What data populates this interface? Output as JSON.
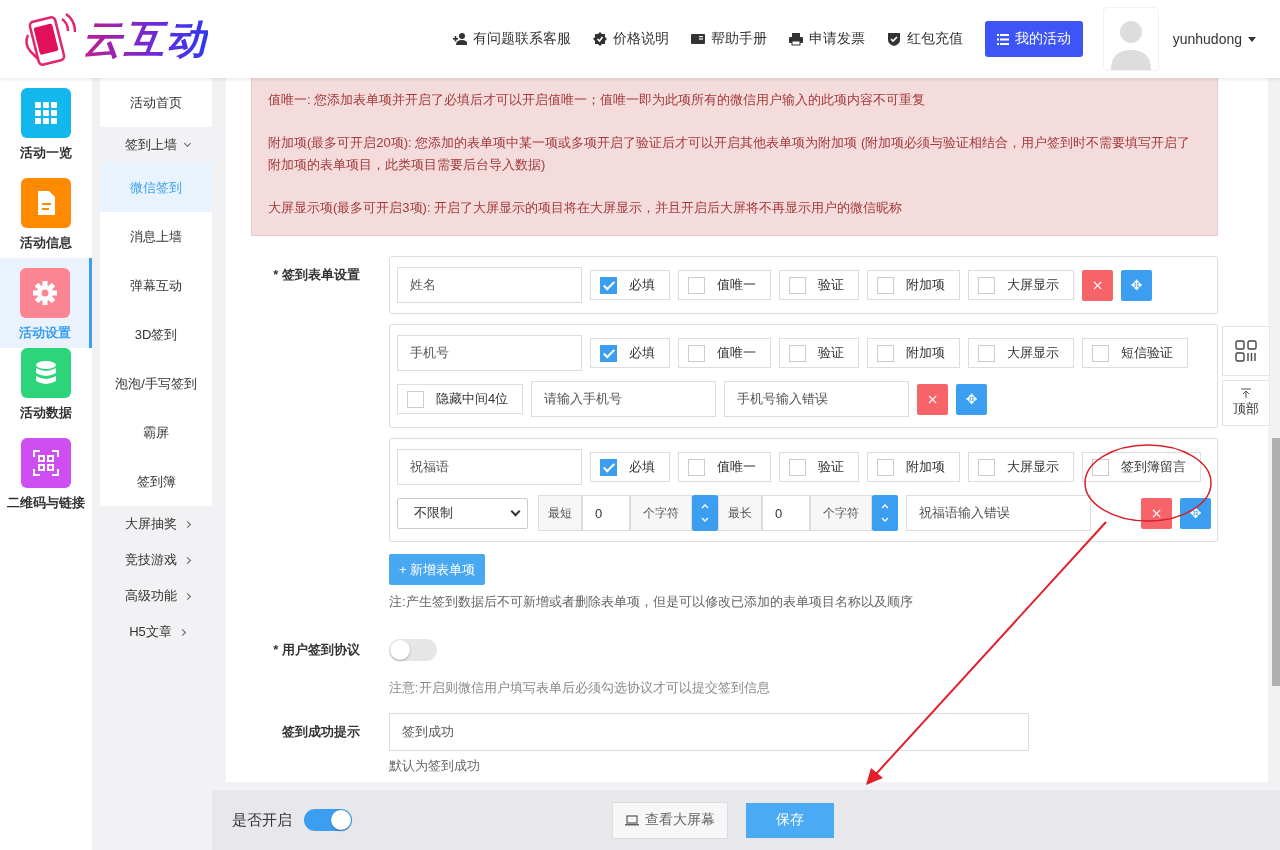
{
  "header": {
    "logo_text": "云互动",
    "nav": [
      {
        "label": "有问题联系客服"
      },
      {
        "label": "价格说明"
      },
      {
        "label": "帮助手册"
      },
      {
        "label": "申请发票"
      },
      {
        "label": "红包充值"
      }
    ],
    "primary_button": "我的活动",
    "username": "yunhudong"
  },
  "rail": [
    {
      "label": "活动一览",
      "color": "#12b7ee",
      "selected": false
    },
    {
      "label": "活动信息",
      "color": "#ff8a00",
      "selected": false
    },
    {
      "label": "活动设置",
      "color": "#fc8493",
      "selected": true
    },
    {
      "label": "活动数据",
      "color": "#2ed47a",
      "selected": false
    },
    {
      "label": "二维码与链接",
      "color": "#cf4ef2",
      "selected": false
    }
  ],
  "submenu": [
    {
      "label": "活动首页",
      "selected": false
    },
    {
      "label": "签到上墙",
      "expanded": true,
      "selected": false,
      "children": [
        {
          "label": "微信签到",
          "selected": true
        },
        {
          "label": "消息上墙",
          "selected": false
        },
        {
          "label": "弹幕互动",
          "selected": false
        },
        {
          "label": "3D签到",
          "selected": false
        },
        {
          "label": "泡泡/手写签到",
          "selected": false
        },
        {
          "label": "霸屏",
          "selected": false
        },
        {
          "label": "签到簿",
          "selected": false
        }
      ]
    },
    {
      "label": "大屏抽奖",
      "expanded": false,
      "selected": false
    },
    {
      "label": "竞技游戏",
      "expanded": false,
      "selected": false
    },
    {
      "label": "高级功能",
      "expanded": false,
      "selected": false
    },
    {
      "label": "H5文章",
      "expanded": false,
      "selected": false
    }
  ],
  "notice": [
    "值唯一: 您添加表单项并开启了必填后才可以开启值唯一；值唯一即为此项所有的微信用户输入的此项内容不可重复",
    "附加项(最多可开启20项): 您添加的表单项中某一项或多项开启了验证后才可以开启其他表单项为附加项 (附加项必须与验证相结合，用户签到时不需要填写开启了附加项的表单项目，此类项目需要后台导入数据)",
    "大屏显示项(最多可开启3项): 开启了大屏显示的项目将在大屏显示，并且开启后大屏将不再显示用户的微信昵称"
  ],
  "form_label": "* 签到表单设置",
  "fields": [
    {
      "name": "姓名",
      "options": [
        {
          "label": "必填",
          "checked": true
        },
        {
          "label": "值唯一",
          "checked": false
        },
        {
          "label": "验证",
          "checked": false
        },
        {
          "label": "附加项",
          "checked": false
        },
        {
          "label": "大屏显示",
          "checked": false
        }
      ],
      "delete": "×",
      "move": "✥"
    },
    {
      "name": "手机号",
      "options": [
        {
          "label": "必填",
          "checked": true
        },
        {
          "label": "值唯一",
          "checked": false
        },
        {
          "label": "验证",
          "checked": false
        },
        {
          "label": "附加项",
          "checked": false
        },
        {
          "label": "大屏显示",
          "checked": false
        },
        {
          "label": "短信验证",
          "checked": false
        }
      ],
      "extra": {
        "kind": "phone",
        "mask": {
          "label": "隐藏中间4位",
          "checked": false
        },
        "placeholder_text": "请输入手机号",
        "error_text": "手机号输入错误"
      },
      "delete": "×",
      "move": "✥"
    },
    {
      "name": "祝福语",
      "options": [
        {
          "label": "必填",
          "checked": true
        },
        {
          "label": "值唯一",
          "checked": false
        },
        {
          "label": "验证",
          "checked": false
        },
        {
          "label": "附加项",
          "checked": false
        },
        {
          "label": "大屏显示",
          "checked": false
        },
        {
          "label": "签到簿留言",
          "checked": false
        }
      ],
      "extra": {
        "kind": "length",
        "limit": "不限制",
        "min_label": "最短",
        "min": "0",
        "min_unit": "个字符",
        "max_label": "最长",
        "max": "0",
        "max_unit": "个字符",
        "error_text": "祝福语输入错误"
      },
      "delete": "×",
      "move": "✥"
    }
  ],
  "add_button": "+ 新增表单项",
  "form_note": "注:产生签到数据后不可新增或者删除表单项，但是可以修改已添加的表单项目名称以及顺序",
  "agreement": {
    "label": "* 用户签到协议",
    "on": false,
    "note": "注意:开启则微信用户填写表单后必须勾选协议才可以提交签到信息"
  },
  "success": {
    "label": "签到成功提示",
    "value": "签到成功",
    "hint": "默认为签到成功"
  },
  "float_buttons": {
    "top": "顶部"
  },
  "footer": {
    "enable_label": "是否开启",
    "enabled": true,
    "preview_button": "查看大屏幕",
    "save_button": "保存"
  }
}
